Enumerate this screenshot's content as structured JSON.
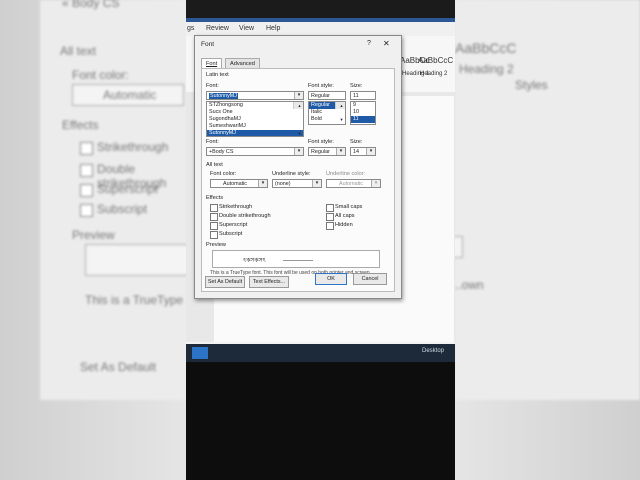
{
  "background": {
    "left_labels": [
      "« Body CS",
      "All text",
      "Font color:",
      "Automatic",
      "Effects",
      "Strikethrough",
      "Double strikethrough",
      "Superscript",
      "Subscript",
      "Preview",
      "This is a TrueType",
      "Set As Default"
    ],
    "right_labels": [
      "AaBbCcC",
      "Heading 2",
      "Styles",
      "..own"
    ]
  },
  "ribbon": {
    "tabs": [
      "gs",
      "Review",
      "View",
      "Help"
    ],
    "styles": [
      {
        "sample": "AaBbCc",
        "label": "Heading 1"
      },
      {
        "sample": "AaBbCcC",
        "label": "Heading 2"
      }
    ]
  },
  "taskbar": {
    "desktop_label": "Desktop"
  },
  "dialog": {
    "title": "Font",
    "help": "?",
    "close": "✕",
    "tabs": [
      "Font",
      "Advanced"
    ],
    "latin_text_heading": "Latin text",
    "font_label": "Font:",
    "font_value": "SutonnyMJ",
    "font_list": [
      "STZhongsong",
      "Sucs One",
      "SugondhaMJ",
      "SumeshwariMJ",
      "SutonnyMJ"
    ],
    "font_list_selected": 4,
    "style_label": "Font style:",
    "style_value": "Regular",
    "style_list": [
      "Regular",
      "Italic",
      "Bold"
    ],
    "size_label": "Size:",
    "size_value": "11",
    "size_list": [
      "9",
      "10",
      "11"
    ],
    "complex_font_label": "Font:",
    "complex_font_value": "+Body CS",
    "complex_style_label": "Font style:",
    "complex_style_value": "Regular",
    "complex_size_label": "Size:",
    "complex_size_value": "14",
    "all_text_heading": "All text",
    "font_color_label": "Font color:",
    "font_color_value": "Automatic",
    "underline_style_label": "Underline style:",
    "underline_style_value": "(none)",
    "underline_color_label": "Underline color:",
    "underline_color_value": "Automatic",
    "effects_heading": "Effects",
    "effects_left": [
      "Strikethrough",
      "Double strikethrough",
      "Superscript",
      "Subscript"
    ],
    "effects_right": [
      "Small caps",
      "All caps",
      "Hidden"
    ],
    "preview_label": "Preview",
    "preview_text": "ৎকসকসৎ",
    "note": "This is a TrueType font. This font will be used on both printer and screen.",
    "buttons": {
      "set_default": "Set As Default",
      "text_effects": "Text Effects...",
      "ok": "OK",
      "cancel": "Cancel"
    }
  }
}
